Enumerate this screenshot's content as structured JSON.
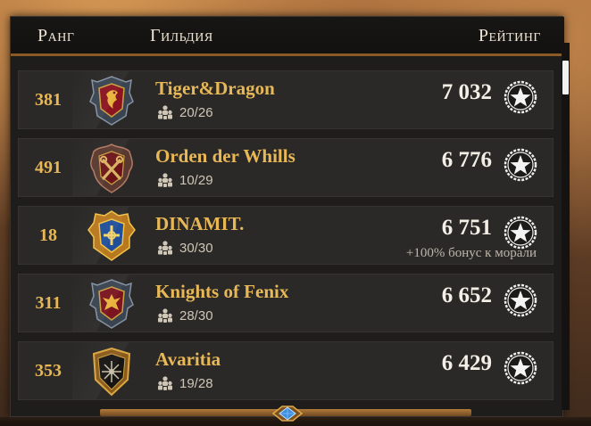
{
  "header": {
    "rank_label": "Ранг",
    "guild_label": "Гильдия",
    "rating_label": "Рейтинг"
  },
  "rows": [
    {
      "rank": "381",
      "name": "Tiger&Dragon",
      "members": "20/26",
      "rating": "7 032",
      "bonus": "",
      "emblem": "dragon-shield-icon"
    },
    {
      "rank": "491",
      "name": "Orden der Whills",
      "members": "10/29",
      "rating": "6 776",
      "bonus": "",
      "emblem": "crossed-keys-shield-icon"
    },
    {
      "rank": "18",
      "name": "DINAMIT.",
      "members": "30/30",
      "rating": "6 751",
      "bonus": "+100% бонус к морали",
      "emblem": "cross-shield-icon"
    },
    {
      "rank": "311",
      "name": "Knights of Fenix",
      "members": "28/30",
      "rating": "6 652",
      "bonus": "",
      "emblem": "phoenix-shield-icon"
    },
    {
      "rank": "353",
      "name": "Avaritia",
      "members": "19/28",
      "rating": "6 429",
      "bonus": "",
      "emblem": "star-shield-icon"
    }
  ],
  "colors": {
    "accent_gold": "#e8b856",
    "panel_bg": "#1f1d1c",
    "row_bg": "#2b2927"
  }
}
